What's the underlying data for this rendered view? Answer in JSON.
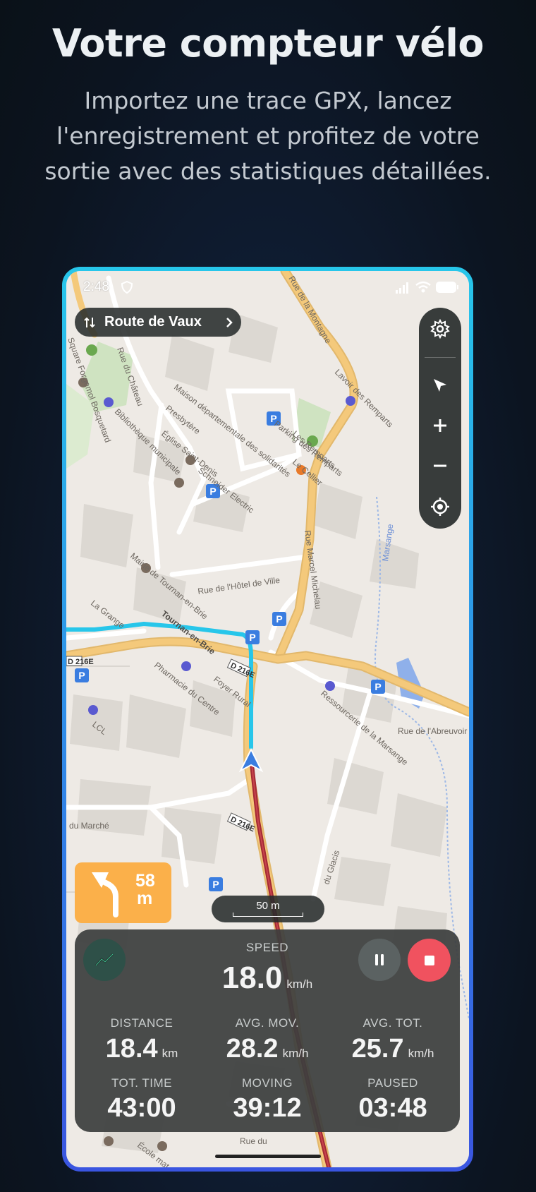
{
  "header": {
    "title": "Votre compteur vélo",
    "subtitle": "Importez une trace GPX, lancez l'enregistrement et profitez de votre sortie avec des statistiques détaillées."
  },
  "status_bar": {
    "time": "2:48"
  },
  "route": {
    "name": "Route de Vaux"
  },
  "map": {
    "labels": {
      "rue_montagne": "Rue de la Montagne",
      "square": "Square Forgemol Bosquetard",
      "rue_chateau": "Rue du Château",
      "maison": "Maison départementale des solidarités",
      "parking_remparts": "Parking des Remparts",
      "lavoir": "Lavoir des Remparts",
      "bibliotheque": "Bibliothèque municipale",
      "presbytere": "Presbytère",
      "eglise": "Église Saint-Denis",
      "schneider": "Schneider Electric",
      "remparts": "Les Remparts",
      "cellier": "Le Cellier",
      "rue_marcel": "Rue Marcel Michelau",
      "mairie": "Mairie de Tournan-en-Brie",
      "rue_hotel": "Rue de l'Hôtel de Ville",
      "grange": "La Grange",
      "tournan": "Tournan-en-Brie",
      "pharmacie": "Pharmacie du Centre",
      "foyer": "Foyer Rural",
      "ressourcerie": "Ressourcerie de la Marsange",
      "rue_abreuvoir": "Rue de l'Abreuvoir",
      "marsange": "Marsange",
      "d216e": "D 216E",
      "lcl": "LCL",
      "marche": "du Marché",
      "glacis": "du Glacis",
      "rue_bas": "Rue du",
      "ecole": "École mat..."
    }
  },
  "navigation": {
    "distance": "58",
    "unit": "m"
  },
  "scale": {
    "label": "50 m"
  },
  "stats": {
    "speed": {
      "label": "SPEED",
      "value": "18.0",
      "unit": "km/h"
    },
    "distance": {
      "label": "DISTANCE",
      "value": "18.4",
      "unit": "km"
    },
    "avg_mov": {
      "label": "AVG. MOV.",
      "value": "28.2",
      "unit": "km/h"
    },
    "avg_tot": {
      "label": "AVG. TOT.",
      "value": "25.7",
      "unit": "km/h"
    },
    "tot_time": {
      "label": "TOT. TIME",
      "value": "43:00"
    },
    "moving": {
      "label": "MOVING",
      "value": "39:12"
    },
    "paused": {
      "label": "PAUSED",
      "value": "03:48"
    }
  },
  "colors": {
    "route_cyan": "#27c6ea",
    "track_red": "#a32b34",
    "turn_orange": "#fbb04a",
    "stop_red": "#f0525f",
    "main_road": "#f4c97b"
  },
  "icons": [
    "shield-icon",
    "signal-icon",
    "wifi-icon",
    "battery-icon",
    "route-swap-icon",
    "chevron-right-icon",
    "gear-icon",
    "pointer-icon",
    "plus-icon",
    "minus-icon",
    "locate-icon",
    "turn-left-icon",
    "chart-icon",
    "pause-icon",
    "stop-icon",
    "position-arrow-icon"
  ]
}
